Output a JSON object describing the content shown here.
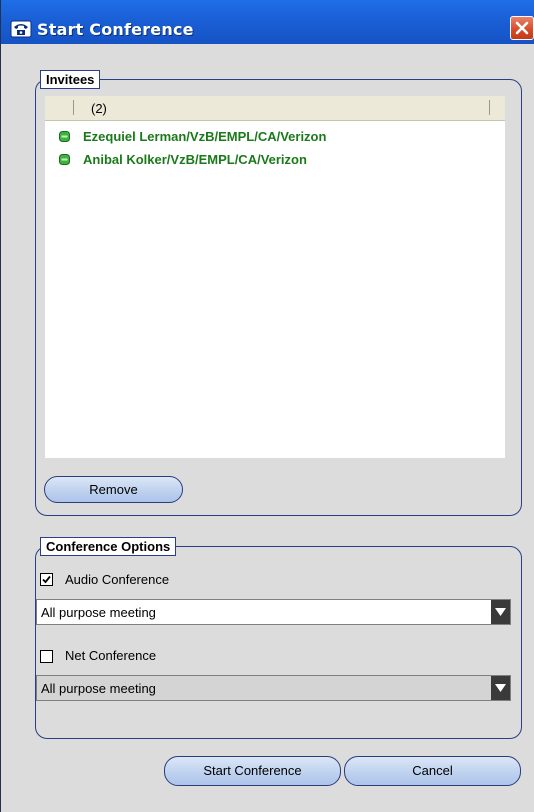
{
  "window": {
    "title": "Start Conference",
    "close_icon": "close-icon",
    "title_icon": "conference-phone-icon"
  },
  "invitees": {
    "legend": "Invitees",
    "header_count": "(2)",
    "items": [
      {
        "name": "Ezequiel Lerman/VzB/EMPL/CA/Verizon",
        "status_icon": "online-status-icon"
      },
      {
        "name": "Anibal Kolker/VzB/EMPL/CA/Verizon",
        "status_icon": "online-status-icon"
      }
    ],
    "remove_label": "Remove"
  },
  "options": {
    "legend": "Conference Options",
    "audio": {
      "label": "Audio Conference",
      "checked": true,
      "selected": "All purpose meeting"
    },
    "net": {
      "label": "Net Conference",
      "checked": false,
      "selected": "All purpose meeting"
    }
  },
  "buttons": {
    "start_label": "Start Conference",
    "cancel_label": "Cancel"
  },
  "colors": {
    "title_bar": "#1a5fd6",
    "invitee_text": "#1a7a1a",
    "status_dot": "#3cb43c",
    "border": "#2a3e86"
  }
}
